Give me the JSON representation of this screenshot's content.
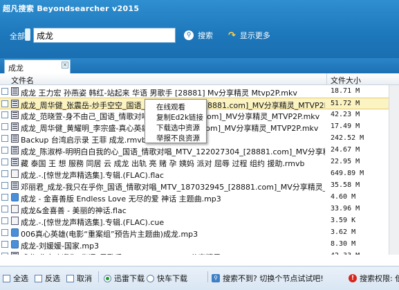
{
  "app": {
    "title": "超凡搜索 Beyondsearcher v2015"
  },
  "search": {
    "scope_label": "全部",
    "query": "成龙",
    "search_label": "搜索",
    "more_label": "显示更多"
  },
  "tabs": [
    {
      "label": "成龙"
    }
  ],
  "table": {
    "columns": {
      "name": "文件名",
      "size": "文件大小"
    },
    "rows": [
      {
        "icon": "video-file-icon",
        "name": "成龙 王力宏 孙燕姿 韩红-站起来 华语 男歌手 [28881] Mv分享精灵 Mtvp2P.mkv",
        "size": "18.71 M"
      },
      {
        "icon": "video-file-icon",
        "name": "成龙_周华健_张震岳-炒手空空_国语_情歌对唱_MTV_[28881.com]_MV分享精灵_MTVP2P.mkv",
        "size": "51.72 M",
        "selected": true
      },
      {
        "icon": "video-file-icon",
        "name": "成龙_范晓萱-身不由己_国语_情歌对唱_MTV_[28881.com]_MV分享精灵_MTVP2P.mkv",
        "size": "42.23 M"
      },
      {
        "icon": "video-file-icon",
        "name": "成龙_周华健_黄耀明_李宗盛-真心英雄_华语_[28881.com]_MV分享精灵_MTVP2P.mkv",
        "size": "17.49 M"
      },
      {
        "icon": "video-file-icon",
        "name": "Backup 台湾启示录 王菲 成龙.rmvb",
        "size": "242.52 M"
      },
      {
        "icon": "video-file-icon",
        "name": "成龙_陈淑桦-明明白白我的心_国语_情歌对唱_MTV_122027304_[28881.com]_MV分享精灵_MTVP2P.mkv",
        "size": "24.67 M"
      },
      {
        "icon": "video-file-icon",
        "name": "藏 泰国 王 想 服務 同居 云 成龙 出轨 亮 赌 孕 姨妈 派对 屈辱 过程 组约 援助.rmvb",
        "size": "22.95 M"
      },
      {
        "icon": "doc-file-icon",
        "name": "成龙.-.[惊世龙声精选集].专辑.(FLAC).flac",
        "size": "649.89 M"
      },
      {
        "icon": "video-file-icon",
        "name": "邓丽君_成龙-我只在乎你_国语_情歌对唱_MTV_187032945_[28881.com]_MV分享精灵_MTVP2P.mkv",
        "size": "35.58 M"
      },
      {
        "icon": "audio-file-icon",
        "name": "成龙 - 金喜善版 Endless Love 无尽的爱 神话 主题曲.mp3",
        "size": "4.60 M"
      },
      {
        "icon": "doc-file-icon",
        "name": "成龙&金喜善 - 美丽的神话.flac",
        "size": "33.96 M"
      },
      {
        "icon": "doc-file-icon",
        "name": "成龙.-.[惊世龙声精选集].专辑.(FLAC).cue",
        "size": "3.59 K"
      },
      {
        "icon": "audio-file-icon",
        "name": "006真心英雄(电影“重案组”预告片主题曲)成龙.mp3",
        "size": "3.62 M"
      },
      {
        "icon": "audio-file-icon",
        "name": "成龙-刘媛媛-国家.mp3",
        "size": "8.30 M"
      },
      {
        "icon": "video-file-icon",
        "name": "成龙-北京欢迎你_华语_男歌手_[28881.com]_MV分享精灵_MTVP2P.mkv",
        "size": "42.33 M"
      }
    ]
  },
  "context_menu": {
    "items": [
      "在线观看",
      "复制Ed2k链接",
      "下载选中资源",
      "举报不良资源"
    ]
  },
  "bottom": {
    "select_all": "全选",
    "invert": "反选",
    "cancel": "取消",
    "thunder_download": "迅雷下载",
    "kuaiche_download": "快车下载",
    "no_results_hint": "搜索不到? 切换个节点试试吧!",
    "permission_hint": "搜索权限: 低",
    "selected_download": "thunder"
  }
}
